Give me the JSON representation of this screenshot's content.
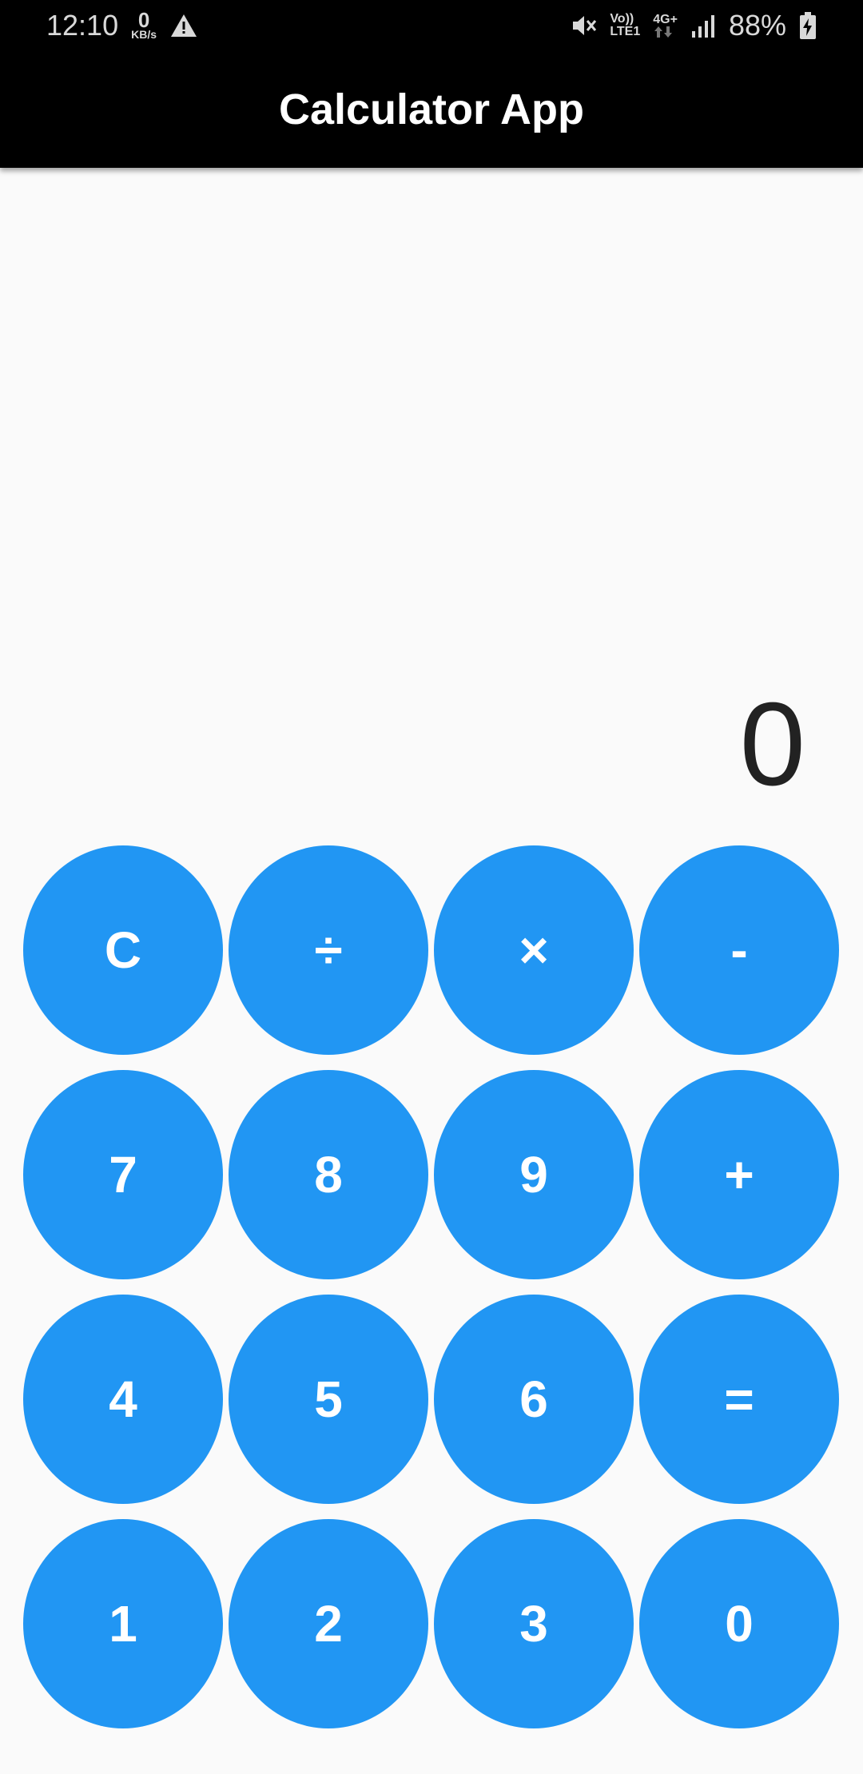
{
  "status_bar": {
    "time": "12:10",
    "net_speed_value": "0",
    "net_speed_unit": "KB/s",
    "volte_label": "Vo))",
    "lte_label": "LTE1",
    "network_type": "4G+",
    "battery_percent": "88%"
  },
  "app_bar": {
    "title": "Calculator App"
  },
  "display": {
    "value": "0"
  },
  "keypad": {
    "keys": [
      "C",
      "÷",
      "×",
      "-",
      "7",
      "8",
      "9",
      "+",
      "4",
      "5",
      "6",
      "=",
      "1",
      "2",
      "3",
      "0"
    ]
  },
  "colors": {
    "button": "#2196f3",
    "app_bar": "#000000",
    "background": "#fafafa"
  }
}
